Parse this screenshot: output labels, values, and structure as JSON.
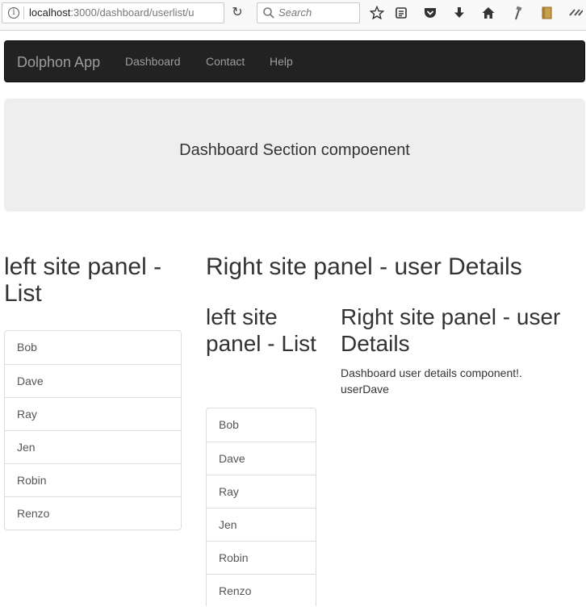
{
  "browser": {
    "url_host": "localhost",
    "url_path": ":3000/dashboard/userlist/u",
    "search_placeholder": "Search",
    "icons": [
      "info-icon",
      "reload-icon",
      "search-icon",
      "bookmark-star-icon",
      "reading-list-icon",
      "pocket-icon",
      "download-icon",
      "home-icon",
      "extension-tool-icon",
      "extension-note-icon",
      "overflow-icon"
    ]
  },
  "navbar": {
    "brand": "Dolphon App",
    "links": [
      "Dashboard",
      "Contact",
      "Help"
    ]
  },
  "jumbotron": {
    "title": "Dashboard Section compoenent"
  },
  "left_panel": {
    "heading": "left site panel - List",
    "users": [
      "Bob",
      "Dave",
      "Ray",
      "Jen",
      "Robin",
      "Renzo"
    ]
  },
  "right_panel": {
    "heading": "Right site panel - user Details",
    "nested_left": {
      "heading": "left site panel - List",
      "users": [
        "Bob",
        "Dave",
        "Ray",
        "Jen",
        "Robin",
        "Renzo"
      ]
    },
    "nested_right": {
      "heading": "Right site panel - user Details",
      "detail_line1": "Dashboard user details component!.",
      "detail_line2": "userDave"
    }
  }
}
